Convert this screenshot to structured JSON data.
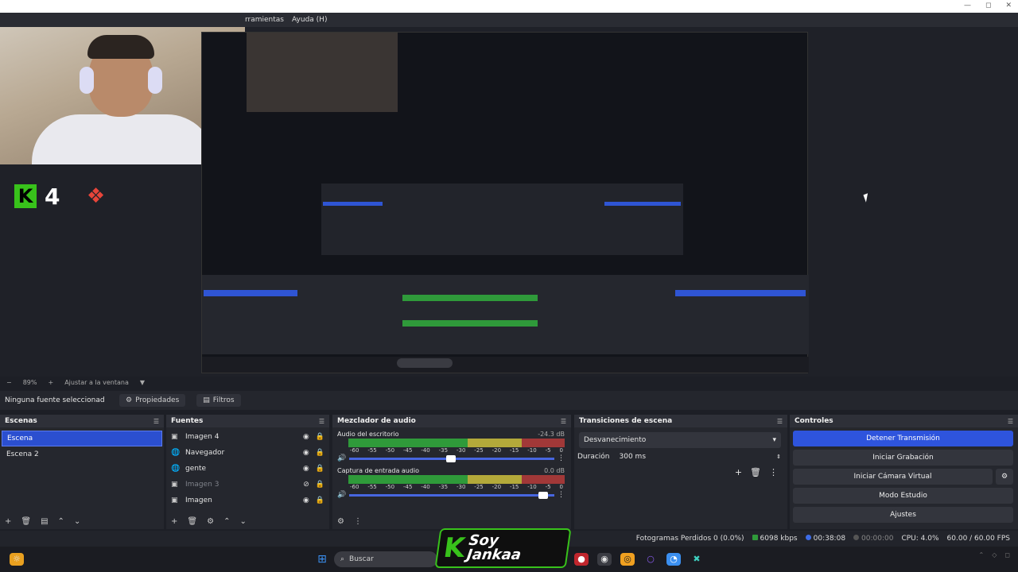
{
  "menubar": {
    "items": [
      "rramientas",
      "Ayuda (H)"
    ]
  },
  "window_controls": {
    "minimize": "—",
    "maximize": "◻",
    "close": "✕"
  },
  "overlay": {
    "k_badge": "K",
    "number": "4"
  },
  "zoom": {
    "minus": "−",
    "value": "89%",
    "plus": "+",
    "fit_label": "Ajustar a la ventana",
    "caret": "▼"
  },
  "source_toolbar": {
    "no_source": "Ninguna fuente seleccionad",
    "properties": "Propiedades",
    "filters": "Filtros"
  },
  "scenes": {
    "title": "Escenas",
    "items": [
      {
        "label": "Escena",
        "selected": true
      },
      {
        "label": "Escena 2",
        "selected": false
      }
    ]
  },
  "sources": {
    "title": "Fuentes",
    "items": [
      {
        "label": "Imagen 4",
        "visible": true,
        "locked": true
      },
      {
        "label": "Navegador",
        "visible": true,
        "locked": true
      },
      {
        "label": "gente",
        "visible": true,
        "locked": true
      },
      {
        "label": "Imagen 3",
        "visible": false,
        "locked": true
      },
      {
        "label": "Imagen",
        "visible": true,
        "locked": true
      }
    ]
  },
  "mixer": {
    "title": "Mezclador de audio",
    "channels": [
      {
        "name": "Audio del escritorio",
        "db": "-24.3 dB",
        "level": 0.52
      },
      {
        "name": "Captura de entrada audio",
        "db": "0.0 dB",
        "level": 0.97
      }
    ],
    "ticks": [
      "-60",
      "-55",
      "-50",
      "-45",
      "-40",
      "-35",
      "-30",
      "-25",
      "-20",
      "-15",
      "-10",
      "-5",
      "0"
    ]
  },
  "transitions": {
    "title": "Transiciones de escena",
    "selected": "Desvanecimiento",
    "duration_label": "Duración",
    "duration_value": "300 ms"
  },
  "controls": {
    "title": "Controles",
    "buttons": [
      "Detener Transmisión",
      "Iniciar Grabación",
      "Iniciar Cámara Virtual",
      "Modo Estudio",
      "Ajustes"
    ]
  },
  "status": {
    "dropped_frames": "Fotogramas Perdidos 0 (0.0%)",
    "bitrate": "6098 kbps",
    "stream_time": "00:38:08",
    "rec_time": "00:00:00",
    "cpu": "CPU: 4.0%",
    "fps": "60.00 / 60.00 FPS"
  },
  "taskbar": {
    "search_placeholder": "Buscar"
  },
  "brand": {
    "logo_line1": "Soy",
    "logo_line2": "Jankaa",
    "k": "K"
  },
  "colors": {
    "accent_blue": "#2e54dd",
    "meter_green": "#2f9a3a",
    "meter_yellow": "#b3a93a",
    "meter_red": "#a13838",
    "brand_green": "#38c21b"
  }
}
